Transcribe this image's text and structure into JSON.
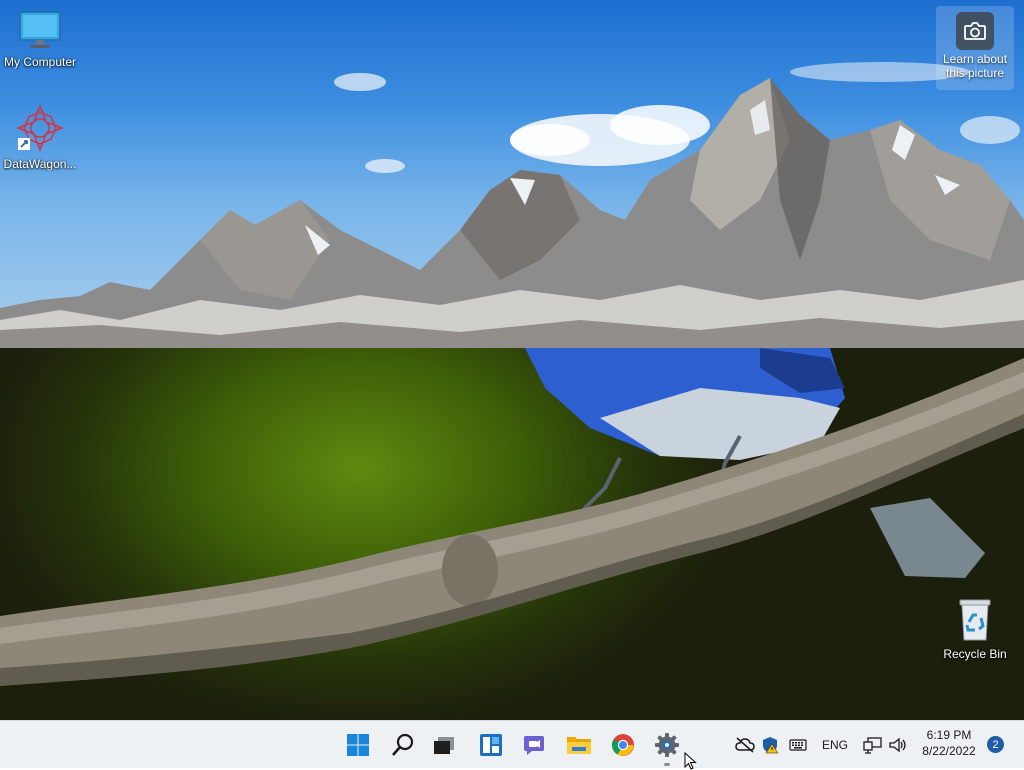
{
  "desktop": {
    "icons": [
      {
        "label": "My Computer",
        "icon": "monitor-icon"
      },
      {
        "label": "DataWagon...",
        "icon": "app-shortcut-icon"
      },
      {
        "label": "Recycle Bin",
        "icon": "recycle-bin-icon"
      }
    ],
    "widget": {
      "label": "Learn about this picture",
      "icon": "camera-icon"
    }
  },
  "taskbar": {
    "apps": [
      {
        "name": "Start",
        "icon": "windows-start-icon"
      },
      {
        "name": "Search",
        "icon": "search-icon"
      },
      {
        "name": "Task View",
        "icon": "task-view-icon"
      },
      {
        "name": "Widgets",
        "icon": "widgets-icon"
      },
      {
        "name": "Chat",
        "icon": "chat-icon"
      },
      {
        "name": "File Explorer",
        "icon": "folder-icon"
      },
      {
        "name": "Google Chrome",
        "icon": "chrome-icon"
      },
      {
        "name": "Settings",
        "icon": "gear-icon"
      }
    ],
    "tray": {
      "language": "ENG",
      "time": "6:19 PM",
      "date": "8/22/2022",
      "notification_count": "2"
    }
  }
}
